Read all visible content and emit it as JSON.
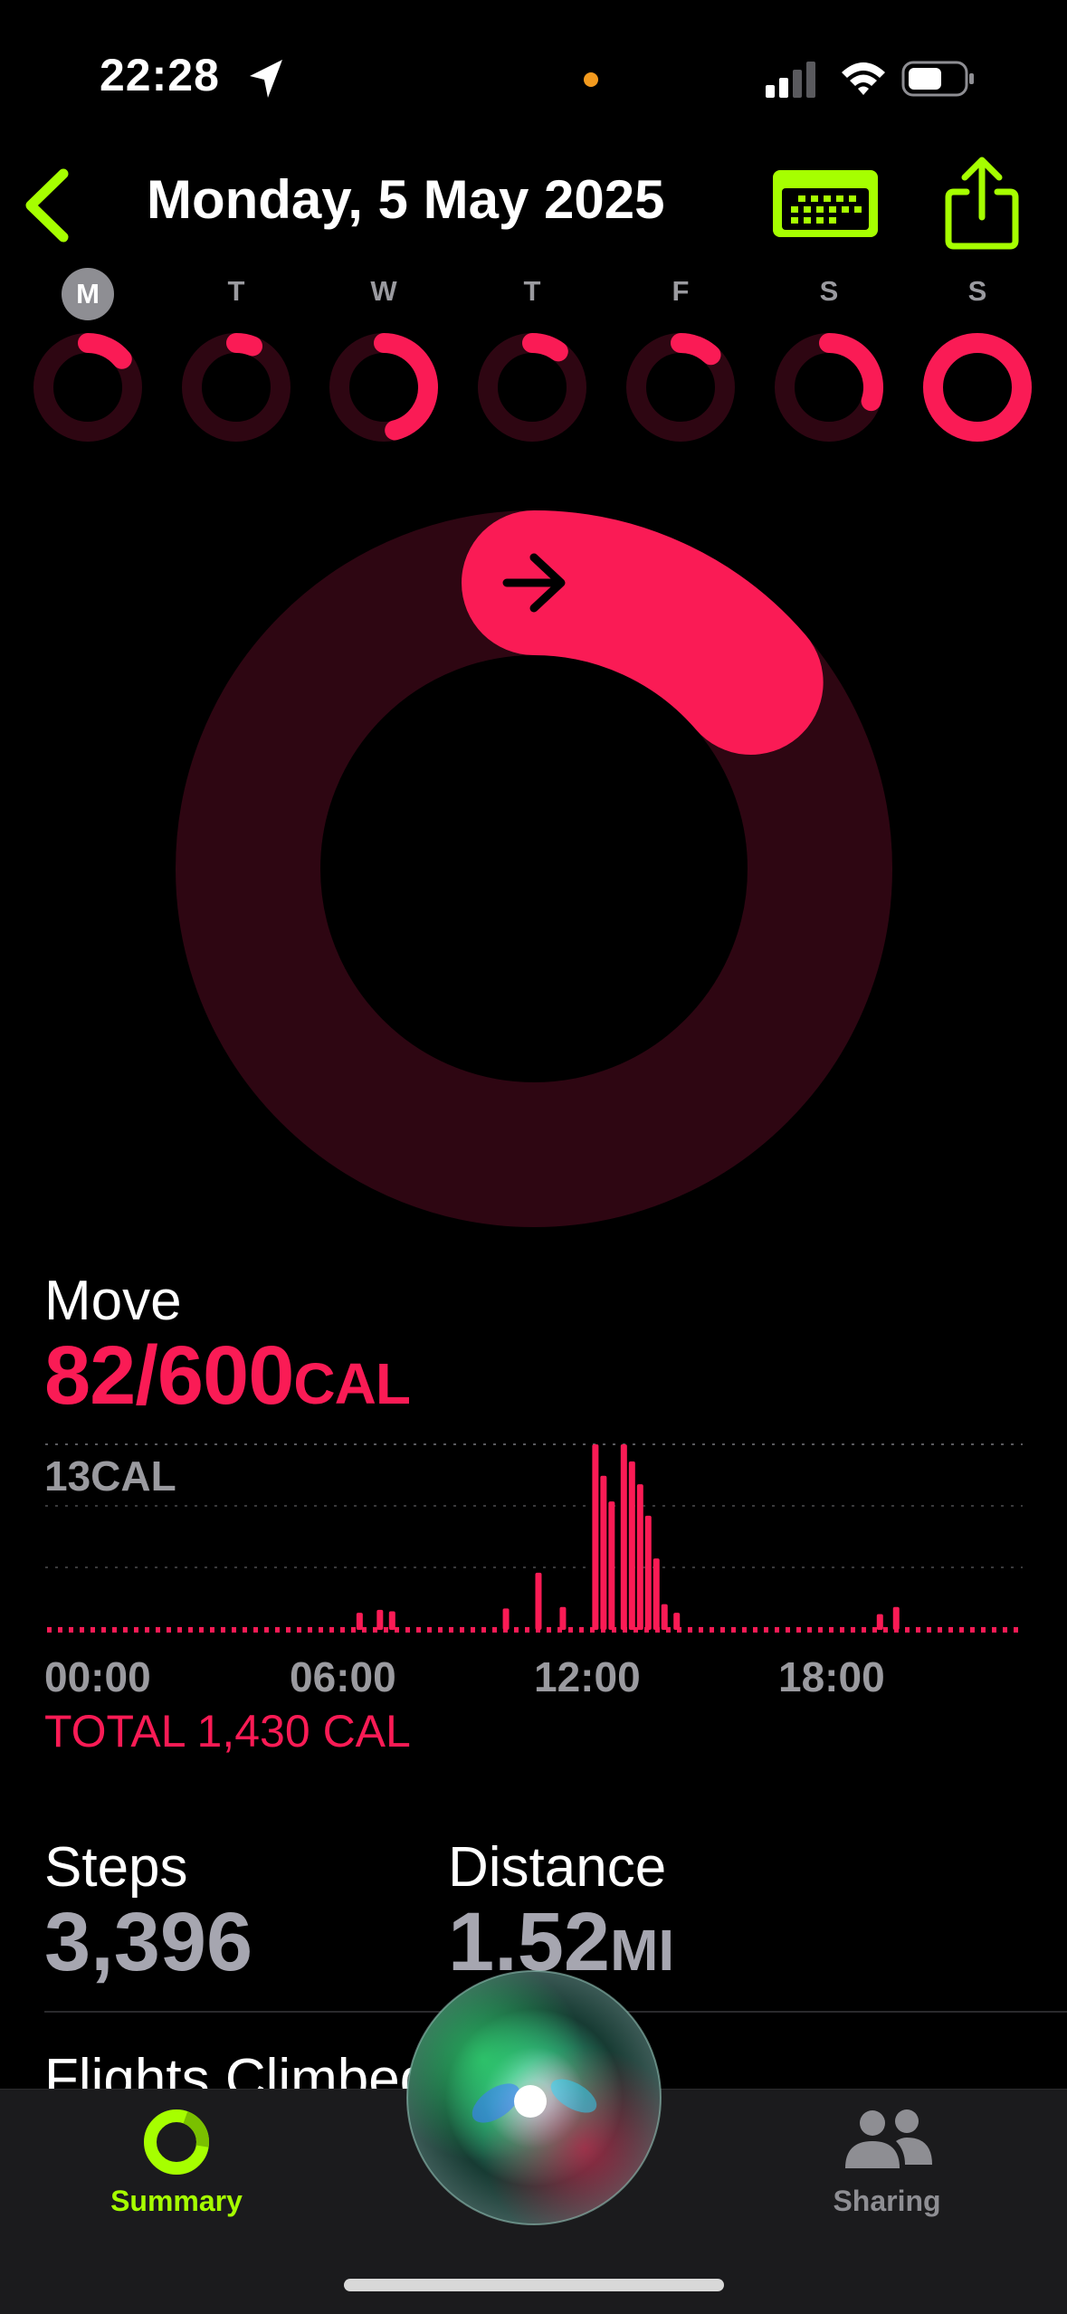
{
  "status_bar": {
    "time": "22:28"
  },
  "header": {
    "date": "Monday, 5 May 2025"
  },
  "week": {
    "days": [
      {
        "letter": "M",
        "progress": 0.14,
        "active": true
      },
      {
        "letter": "T",
        "progress": 0.06,
        "active": false
      },
      {
        "letter": "W",
        "progress": 0.46,
        "active": false
      },
      {
        "letter": "T",
        "progress": 0.1,
        "active": false
      },
      {
        "letter": "F",
        "progress": 0.12,
        "active": false
      },
      {
        "letter": "S",
        "progress": 0.3,
        "active": false
      },
      {
        "letter": "S",
        "progress": 1.0,
        "active": false
      }
    ]
  },
  "move": {
    "label": "Move",
    "value": "82/600",
    "unit": "CAL",
    "progress": 0.137,
    "chart_max_label": "13CAL",
    "x_ticks": [
      "00:00",
      "06:00",
      "12:00",
      "18:00"
    ],
    "total": "TOTAL 1,430 CAL"
  },
  "chart_data": {
    "type": "bar",
    "title": "",
    "ylabel": "13CAL",
    "x_ticks": [
      "00:00",
      "06:00",
      "12:00",
      "18:00"
    ],
    "ylim": [
      0,
      13
    ],
    "x_hours": [
      7.7,
      8.2,
      8.5,
      11.3,
      12.1,
      12.7,
      13.5,
      13.7,
      13.9,
      14.2,
      14.4,
      14.6,
      14.8,
      15.0,
      15.2,
      15.5,
      20.5,
      20.9
    ],
    "values": [
      1.2,
      1.4,
      1.3,
      1.5,
      4.0,
      1.6,
      13.0,
      10.8,
      9.0,
      13.0,
      11.8,
      10.2,
      8.0,
      5.0,
      1.8,
      1.2,
      1.1,
      1.6
    ]
  },
  "steps": {
    "label": "Steps",
    "value": "3,396"
  },
  "distance": {
    "label": "Distance",
    "value": "1.52",
    "unit": "MI"
  },
  "flights": {
    "label": "Flights Climbed"
  },
  "tabs": {
    "summary": "Summary",
    "sharing": "Sharing"
  },
  "colors": {
    "move": "#fa1b55",
    "move_track": "#2e0612",
    "accent": "#a6ff00",
    "muted": "#9a9a9f"
  }
}
